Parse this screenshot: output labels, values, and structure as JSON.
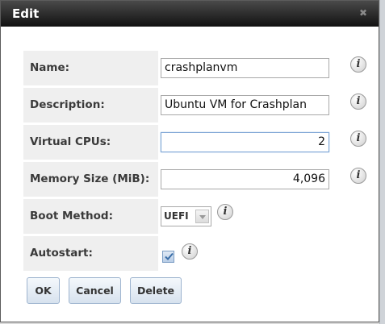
{
  "dialog": {
    "title": "Edit",
    "close_icon": "✖"
  },
  "form": {
    "name": {
      "label": "Name:",
      "value": "crashplanvm"
    },
    "description": {
      "label": "Description:",
      "value": "Ubuntu VM for Crashplan"
    },
    "vcpus": {
      "label": "Virtual CPUs:",
      "value": "2"
    },
    "memory": {
      "label": "Memory Size (MiB):",
      "value": "4,096"
    },
    "boot_method": {
      "label": "Boot Method:",
      "selected": "UEFI"
    },
    "autostart": {
      "label": "Autostart:",
      "checked": true
    }
  },
  "info_icon_glyph": "i",
  "buttons": {
    "ok": "OK",
    "cancel": "Cancel",
    "delete": "Delete"
  },
  "colors": {
    "titlebar": "#111111",
    "label_bg": "#efefef",
    "button_border": "#9eb4cf"
  }
}
